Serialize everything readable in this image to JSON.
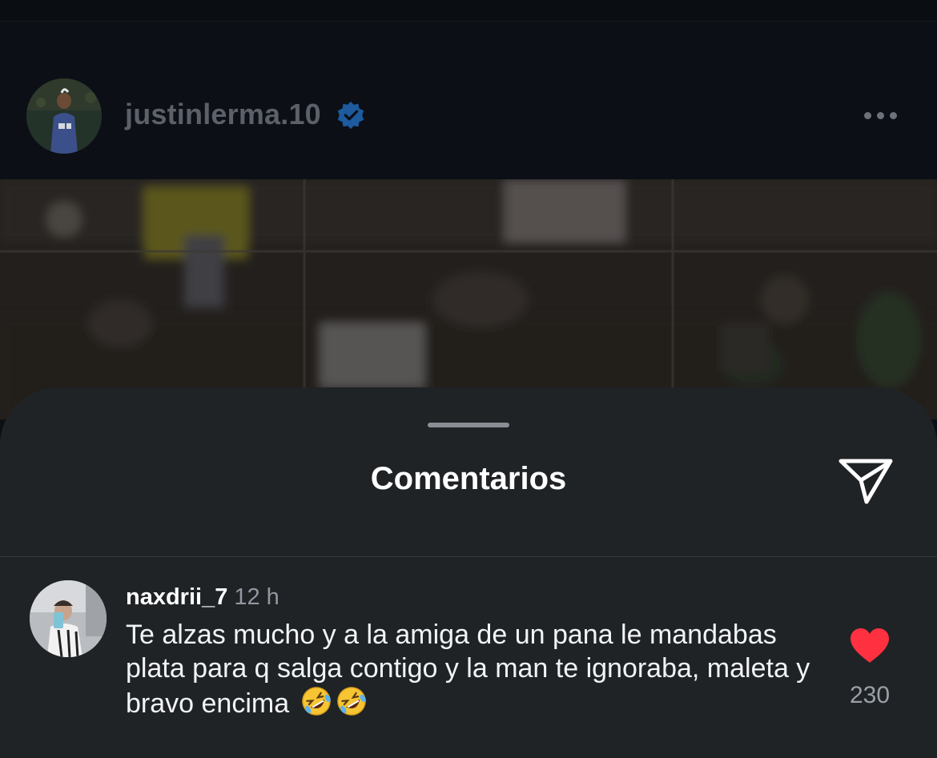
{
  "post": {
    "username": "justinlerma.10",
    "verified": true,
    "more_icon": "more-horizontal-icon"
  },
  "comments_sheet": {
    "title": "Comentarios",
    "share_icon": "paper-plane-icon",
    "comments": [
      {
        "username": "naxdrii_7",
        "time": "12 h",
        "text": "Te alzas mucho y a la amiga de un pana le mandabas plata para q salga contigo y la man te ignoraba, maleta y bravo encima",
        "emojis": [
          "rolling-on-floor-laughing-emoji",
          "rolling-on-floor-laughing-emoji"
        ],
        "liked": true,
        "like_count": "230"
      }
    ]
  },
  "colors": {
    "header_bg": "#0c0f15",
    "sheet_bg": "#1f2326",
    "username_header": "#5b6069",
    "verified_blue": "#1d5a9e",
    "heart_red": "#ff3040",
    "meta_gray": "#9298a0"
  }
}
